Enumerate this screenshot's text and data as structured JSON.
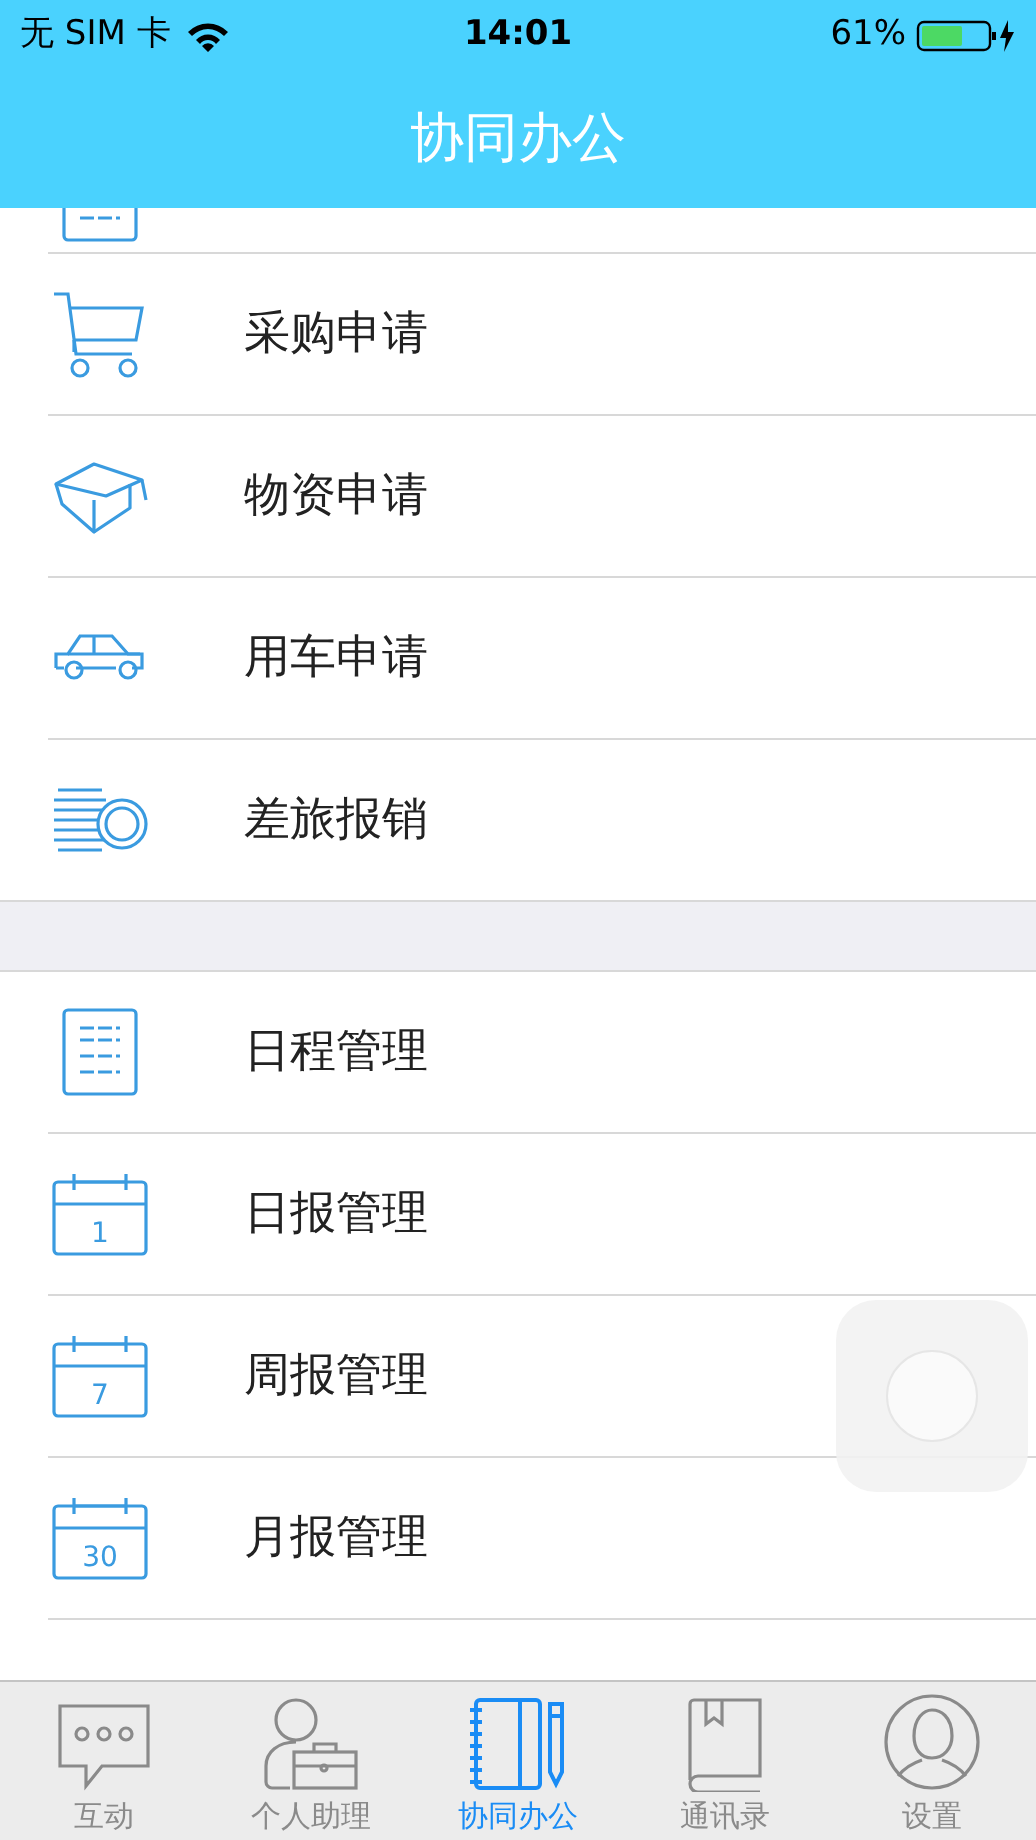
{
  "status_bar": {
    "carrier": "无 SIM 卡",
    "time": "14:01",
    "battery": "61%"
  },
  "header": {
    "title": "协同办公"
  },
  "clipped_item": {
    "kind": "list"
  },
  "groups": [
    {
      "items": [
        {
          "label": "采购申请",
          "kind": "cart"
        },
        {
          "label": "物资申请",
          "kind": "box"
        },
        {
          "label": "用车申请",
          "kind": "car"
        },
        {
          "label": "差旅报销",
          "kind": "coins"
        }
      ]
    },
    {
      "items": [
        {
          "label": "日程管理",
          "kind": "list"
        },
        {
          "label": "日报管理",
          "kind": "calendar",
          "day": "1"
        },
        {
          "label": "周报管理",
          "kind": "calendar",
          "day": "7"
        },
        {
          "label": "月报管理",
          "kind": "calendar",
          "day": "30"
        }
      ]
    }
  ],
  "tabs": [
    {
      "label": "互动",
      "kind": "chat",
      "selected": false
    },
    {
      "label": "个人助理",
      "kind": "assistant",
      "selected": false
    },
    {
      "label": "协同办公",
      "kind": "notebook",
      "selected": true
    },
    {
      "label": "通讯录",
      "kind": "book",
      "selected": false
    },
    {
      "label": "设置",
      "kind": "avatar",
      "selected": false
    }
  ]
}
